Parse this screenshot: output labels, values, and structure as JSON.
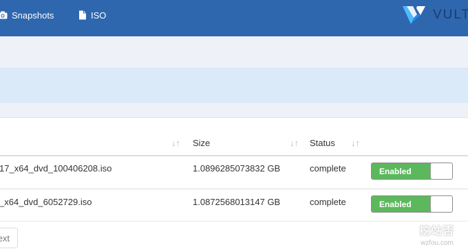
{
  "nav": {
    "items": [
      {
        "label": "Snapshots",
        "icon": "camera-icon"
      },
      {
        "label": "ISO",
        "icon": "file-icon"
      }
    ],
    "logo_text": "VULT"
  },
  "table": {
    "columns": [
      "Size",
      "Status"
    ],
    "rows": [
      {
        "name": "17_x64_dvd_100406208.iso",
        "size": "1.0896285073832 GB",
        "status": "complete",
        "toggle": "Enabled"
      },
      {
        "name": "_x64_dvd_6052729.iso",
        "size": "1.0872568013147 GB",
        "status": "complete",
        "toggle": "Enabled"
      }
    ]
  },
  "pagination": {
    "next_label": "ext"
  },
  "watermark": {
    "main": "挖站否",
    "sub": "wzfou.com"
  },
  "colors": {
    "header": "#2e67ad",
    "enabled": "#5cb85c",
    "band": "#dbeaf8"
  }
}
